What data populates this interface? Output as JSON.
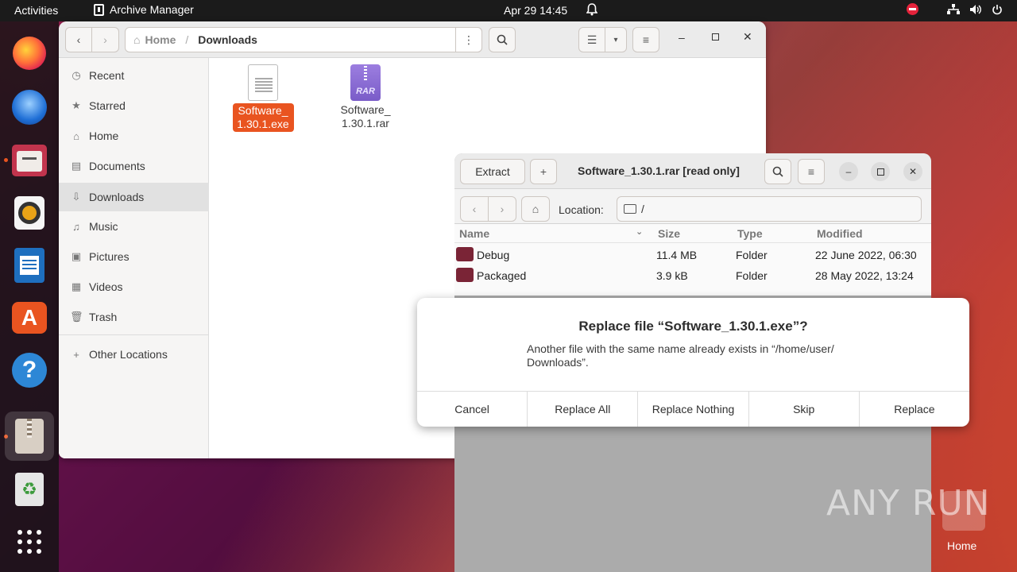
{
  "topbar": {
    "activities": "Activities",
    "app_name": "Archive Manager",
    "clock": "Apr 29  14:45"
  },
  "files": {
    "path_home": "Home",
    "path_current": "Downloads",
    "sidebar": [
      {
        "label": "Recent",
        "icon": "clock-icon"
      },
      {
        "label": "Starred",
        "icon": "star-icon"
      },
      {
        "label": "Home",
        "icon": "home-icon"
      },
      {
        "label": "Documents",
        "icon": "document-icon"
      },
      {
        "label": "Downloads",
        "icon": "download-icon"
      },
      {
        "label": "Music",
        "icon": "music-icon"
      },
      {
        "label": "Pictures",
        "icon": "picture-icon"
      },
      {
        "label": "Videos",
        "icon": "video-icon"
      },
      {
        "label": "Trash",
        "icon": "trash-icon"
      },
      {
        "label": "Other Locations",
        "icon": "plus-icon"
      }
    ],
    "items": [
      {
        "name_l1": "Software_",
        "name_l2": "1.30.1.exe"
      },
      {
        "name_l1": "Software_",
        "name_l2": "1.30.1.rar",
        "badge": "RAR"
      }
    ]
  },
  "archive": {
    "extract_label": "Extract",
    "title": "Software_1.30.1.rar [read only]",
    "location_label": "Location:",
    "location_value": "/",
    "columns": {
      "name": "Name",
      "size": "Size",
      "type": "Type",
      "modified": "Modified"
    },
    "rows": [
      {
        "name": "Debug",
        "size": "11.4 MB",
        "type": "Folder",
        "modified": "22 June 2022, 06:30"
      },
      {
        "name": "Packaged",
        "size": "3.9 kB",
        "type": "Folder",
        "modified": "28 May 2022, 13:24"
      }
    ]
  },
  "dialog": {
    "title": "Replace file “Software_1.30.1.exe”?",
    "msg_l1": "Another file with the same name already exists in “/home/user/",
    "msg_l2": "Downloads”.",
    "buttons": [
      "Cancel",
      "Replace All",
      "Replace Nothing",
      "Skip",
      "Replace"
    ]
  },
  "desktop": {
    "home_label": "Home",
    "watermark": "ANY RUN"
  },
  "colors": {
    "accent": "#e95420",
    "selection": "#e95420"
  }
}
